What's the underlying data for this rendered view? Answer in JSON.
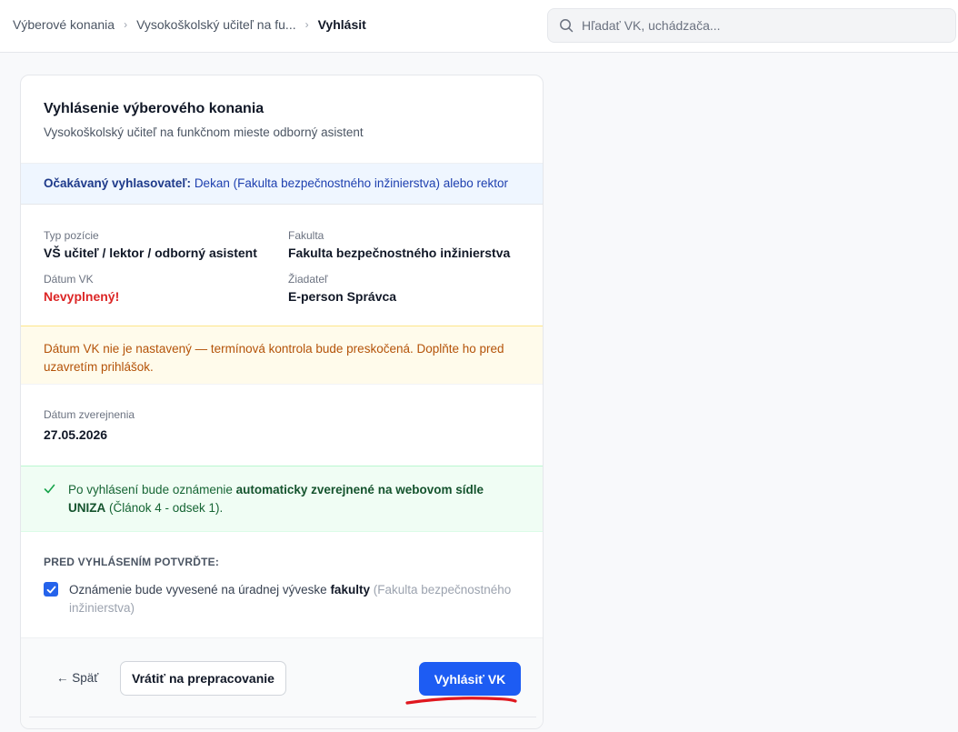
{
  "breadcrumb": {
    "items": [
      "Výberové konania",
      "Vysokoškolský učiteľ na fu...",
      "Vyhlásit"
    ],
    "separator": "›"
  },
  "search": {
    "placeholder": "Hľadať VK, uchádzača...",
    "icon": "search-icon"
  },
  "card": {
    "title": "Vyhlásenie výberového konania",
    "subtitle": "Vysokoškolský učiteľ na funkčnom mieste odborný asistent",
    "announcer": {
      "label": "Očakávaný vyhlasovateľ:",
      "value": "Dekan (Fakulta bezpečnostného inžinierstva) alebo rektor"
    },
    "info": {
      "position_type": {
        "label": "Typ pozície",
        "value": "VŠ učiteľ / lektor / odborný asistent"
      },
      "faculty": {
        "label": "Fakulta",
        "value": "Fakulta bezpečnostného inžinierstva"
      },
      "vk_date": {
        "label": "Dátum VK",
        "value": "Nevyplnený!"
      },
      "applicant": {
        "label": "Žiadateľ",
        "value": "E-person Správca"
      }
    },
    "warning": "Dátum VK nie je nastavený — termínová kontrola bude preskočená. Doplňte ho pred uzavretím prihlášok.",
    "publication": {
      "label": "Dátum zverejnenia",
      "value": "27.05.2026"
    },
    "success": {
      "prefix": "Po vyhlásení bude oznámenie ",
      "bold": "automaticky zverejnené na webovom sídle UNIZA",
      "suffix": " (Článok 4 - odsek 1).",
      "icon": "check-icon"
    },
    "confirm": {
      "heading": "PRED VYHLÁSENÍM POTVRĎTE:",
      "checked": true,
      "text_prefix": "Oznámenie bude vyvesené na úradnej výveske ",
      "text_bold": "fakulty",
      "text_muted": " (Fakulta bezpečnostného inžinierstva)"
    },
    "footer": {
      "back_label": "← Späť",
      "return_label": "Vrátiť na prepracovanie",
      "primary_label": "Vyhlásiť VK"
    }
  },
  "colors": {
    "primary": "#1d5cf3",
    "error": "#dc2626",
    "warning_text": "#b45309",
    "success_text": "#166534",
    "annotation_red": "#e0171e"
  }
}
